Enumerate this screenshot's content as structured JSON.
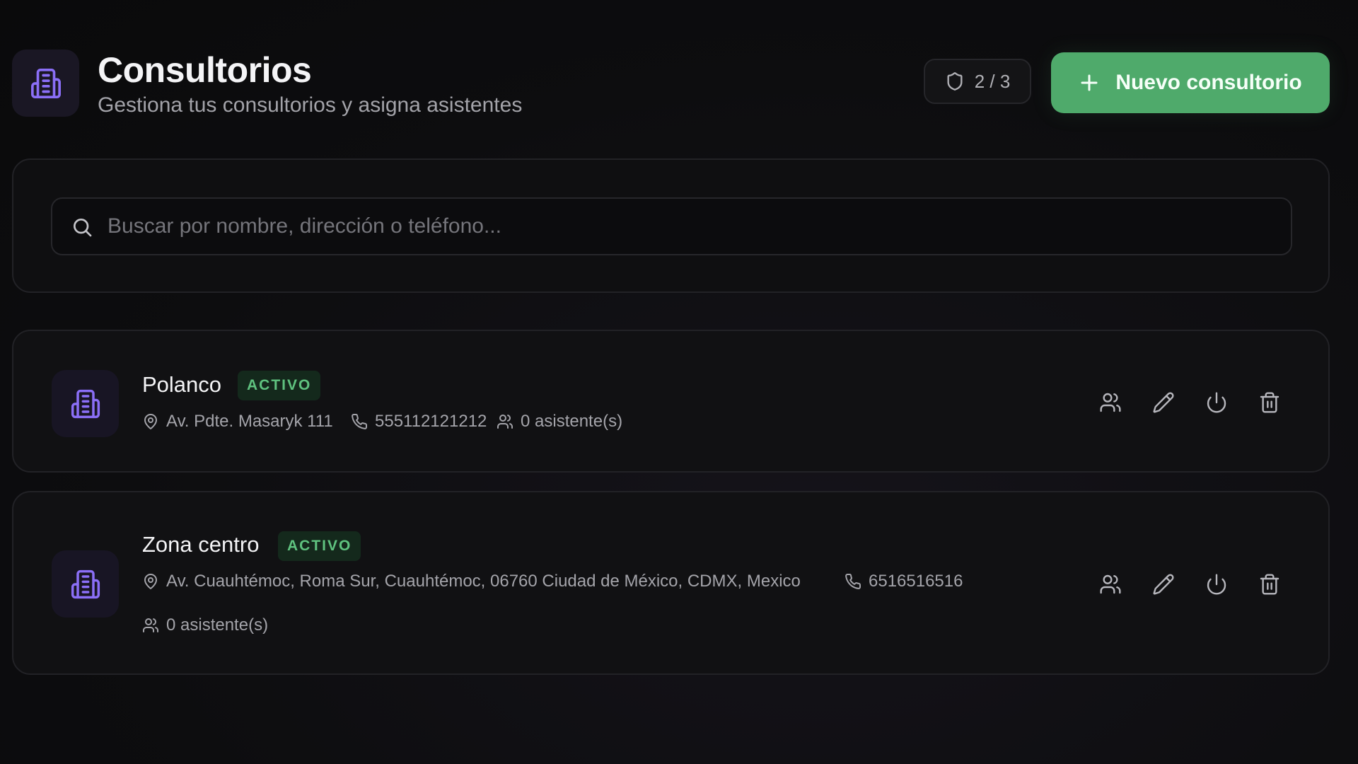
{
  "header": {
    "icon": "building-icon",
    "title": "Consultorios",
    "subtitle": "Gestiona tus consultorios y asigna asistentes",
    "quota": "2 / 3",
    "quota_icon": "shield-icon",
    "new_button_label": "Nuevo consultorio",
    "new_button_icon": "plus-icon"
  },
  "search": {
    "placeholder": "Buscar por nombre, dirección o teléfono...",
    "value": "",
    "icon": "search-icon"
  },
  "offices": [
    {
      "name": "Polanco",
      "status": "ACTIVO",
      "address": "Av. Pdte. Masaryk 111",
      "phone": "555112121212",
      "assistants": "0 asistente(s)"
    },
    {
      "name": "Zona centro",
      "status": "ACTIVO",
      "address": "Av. Cuauhtémoc, Roma Sur, Cuauhtémoc, 06760 Ciudad de México, CDMX, Mexico",
      "phone": "6516516516",
      "assistants": "0 asistente(s)"
    }
  ],
  "action_icons": [
    "users-icon",
    "pencil-icon",
    "power-icon",
    "trash-icon"
  ],
  "colors": {
    "accent_green": "#4faa6b",
    "status_green": "#5fc27f",
    "icon_purple": "#8b6ff7",
    "background": "#0c0c0d"
  }
}
